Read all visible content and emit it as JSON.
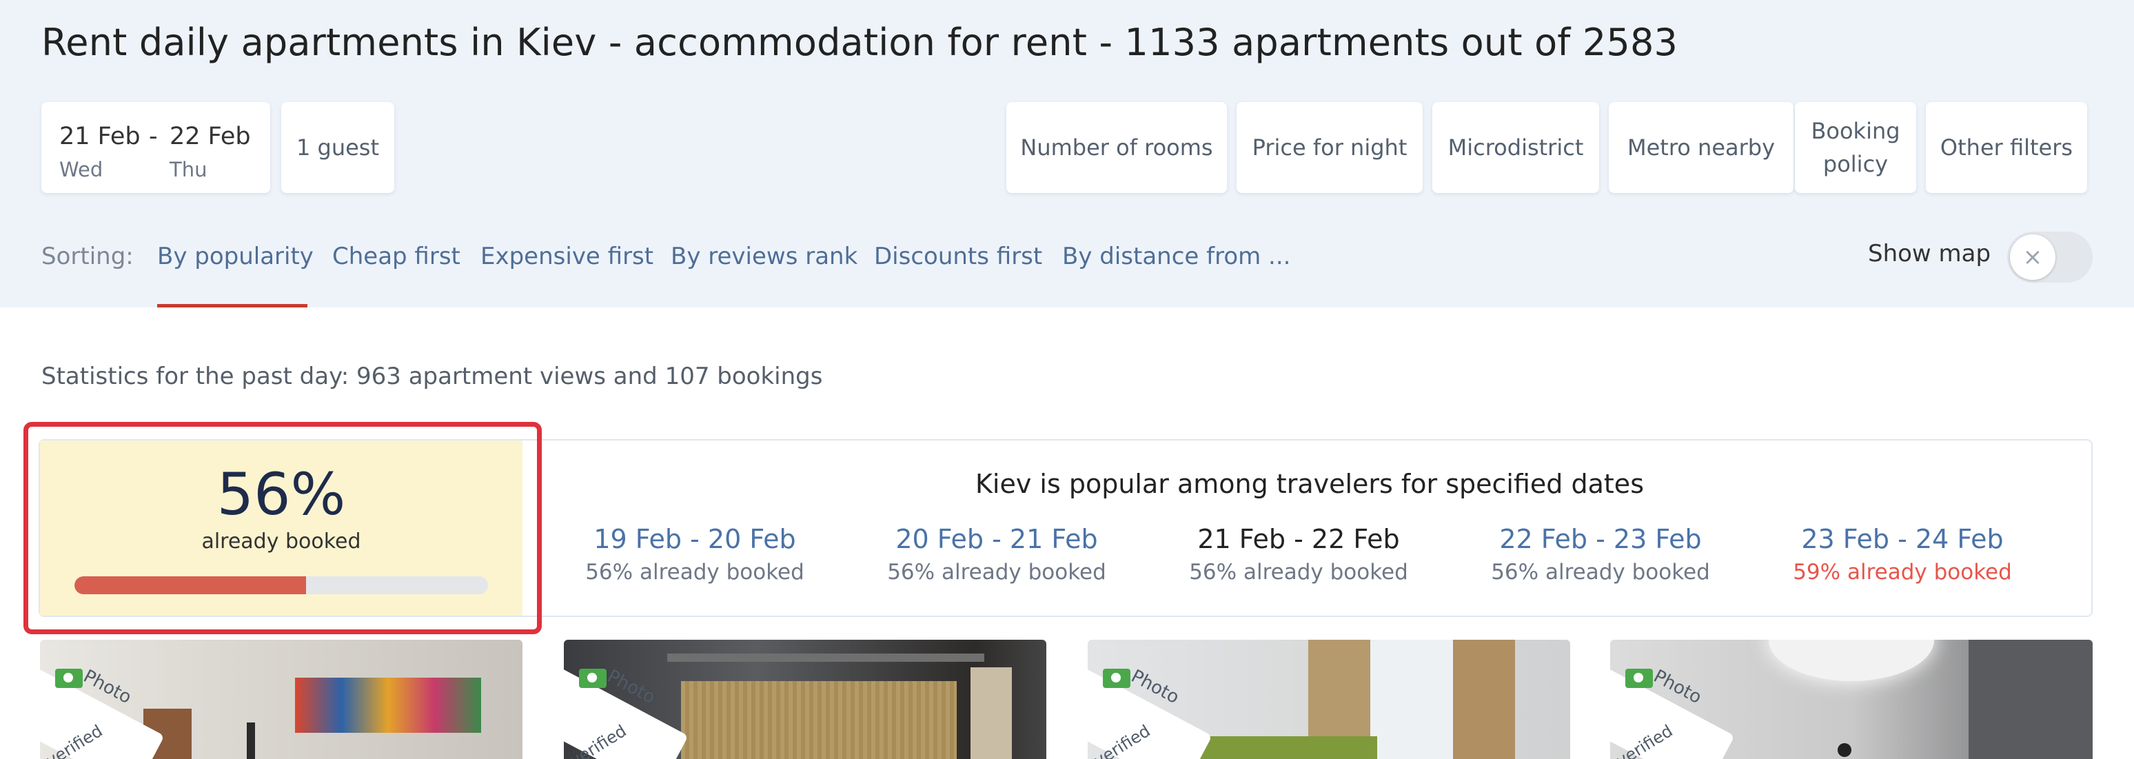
{
  "page": {
    "title": "Rent daily apartments in Kiev - accommodation for rent - 1133 apartments out of 2583"
  },
  "search": {
    "check_in_date": "21 Feb",
    "check_in_day": "Wed",
    "date_separator": "-",
    "check_out_date": "22 Feb",
    "check_out_day": "Thu",
    "guests": "1 guest"
  },
  "filters": {
    "rooms": "Number of rooms",
    "price": "Price for night",
    "microdistrict": "Microdistrict",
    "metro": "Metro nearby",
    "booking_policy_line1": "Booking",
    "booking_policy_line2": "policy",
    "other": "Other filters"
  },
  "sorting": {
    "label": "Sorting:",
    "options": [
      "By popularity",
      "Cheap first",
      "Expensive first",
      "By reviews rank",
      "Discounts first",
      "By distance from ..."
    ],
    "active": "By popularity"
  },
  "map_toggle": {
    "label": "Show map",
    "state_icon": "×",
    "enabled": false
  },
  "stats": {
    "text": "Statistics for the past day: 963 apartment views and 107 bookings"
  },
  "occupancy": {
    "percent_text": "56%",
    "caption": "already booked",
    "fraction": 0.56
  },
  "popularity": {
    "title": "Kiev is popular among travelers for specified dates",
    "days": [
      {
        "range": "19 Feb - 20 Feb",
        "booked": "56% already booked"
      },
      {
        "range": "20 Feb - 21 Feb",
        "booked": "56% already booked"
      },
      {
        "range": "21 Feb - 22 Feb",
        "booked": "56% already booked"
      },
      {
        "range": "22 Feb - 23 Feb",
        "booked": "56% already booked"
      },
      {
        "range": "23 Feb - 24 Feb",
        "booked": "59% already booked"
      }
    ]
  },
  "listings": {
    "badge_word1": "Photo",
    "badge_word2": "verified",
    "cards": [
      {
        "photo_icon": "camera-icon"
      },
      {
        "photo_icon": "camera-icon"
      },
      {
        "photo_icon": "camera-icon"
      },
      {
        "photo_icon": "camera-icon"
      }
    ]
  },
  "colors": {
    "header_bg": "#eef3fa",
    "accent_red": "#c73b2e",
    "link_blue": "#4f6e96",
    "booked_bg": "#fbf4cf",
    "progress_fill": "#d75f50",
    "hot_text": "#e8554a",
    "highlight_frame": "#e0313c"
  }
}
